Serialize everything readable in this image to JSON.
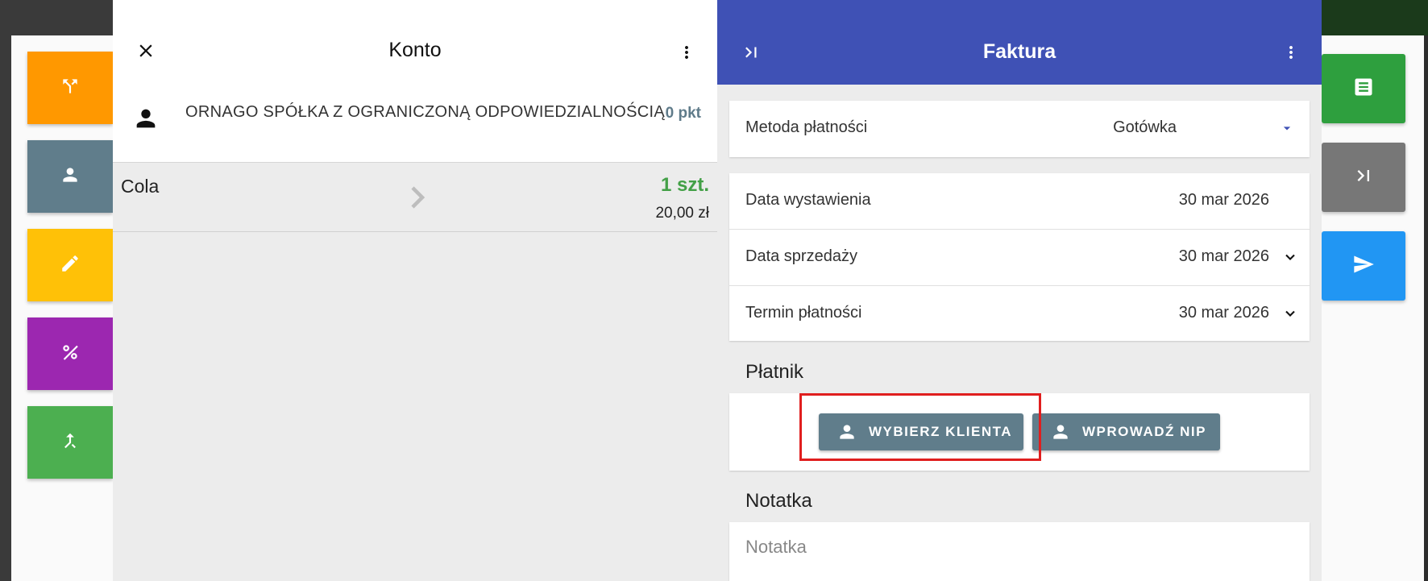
{
  "colors": {
    "konto_btn_orange": "#ff9800",
    "konto_btn_slate": "#607d8b",
    "konto_btn_yellow": "#ffc107",
    "konto_btn_purple": "#9c27b0",
    "konto_btn_green": "#4caf50",
    "right_btn_green": "#2e9f3e",
    "right_btn_gray": "#777777",
    "right_btn_blue": "#2196f3",
    "faktura_header": "#3f51b5",
    "qty_green": "#43a047",
    "points_color": "#5f7b8a",
    "highlight_red": "#e01e1e"
  },
  "left_actions": [
    {
      "icon": "split-icon"
    },
    {
      "icon": "person-icon"
    },
    {
      "icon": "pencil-icon"
    },
    {
      "icon": "percent-icon"
    },
    {
      "icon": "merge-icon"
    }
  ],
  "right_actions": [
    {
      "icon": "receipt-icon"
    },
    {
      "icon": "skip-next-icon"
    },
    {
      "icon": "send-icon"
    }
  ],
  "konto": {
    "title": "Konto",
    "customer": {
      "name": "ORNAGO SPÓŁKA Z OGRANICZONĄ ODPOWIEDZIALNOŚCIĄ",
      "points": "0 pkt"
    },
    "items": [
      {
        "name": "Cola",
        "quantity": "1 szt.",
        "price": "20,00 zł"
      }
    ]
  },
  "faktura": {
    "title": "Faktura",
    "payment_method": {
      "label": "Metoda płatności",
      "value": "Gotówka"
    },
    "issue_date": {
      "label": "Data wystawienia",
      "value": "30 mar 2026"
    },
    "sale_date": {
      "label": "Data sprzedaży",
      "value": "30 mar 2026"
    },
    "payment_term": {
      "label": "Termin płatności",
      "value": "30 mar 2026"
    },
    "payer": {
      "section_title": "Płatnik",
      "select_client_label": "WYBIERZ KLIENTA",
      "enter_nip_label": "WPROWADŹ NIP"
    },
    "note": {
      "section_title": "Notatka",
      "placeholder": "Notatka"
    }
  }
}
